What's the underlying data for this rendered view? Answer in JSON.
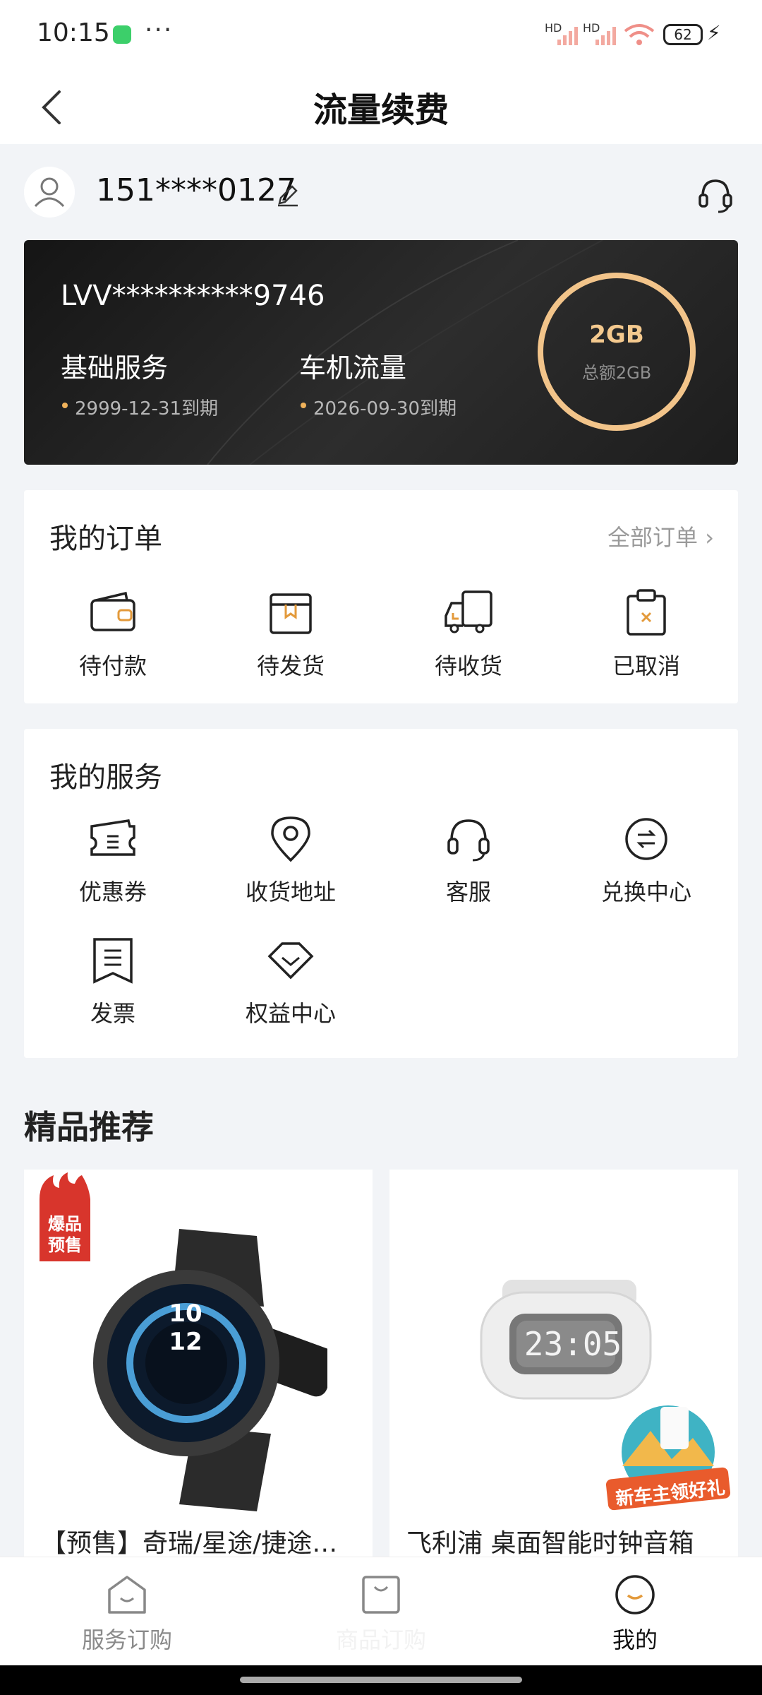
{
  "status_bar": {
    "time": "10:15",
    "battery": "62",
    "sig1": "HD",
    "sig2": "HD"
  },
  "header": {
    "title": "流量续费"
  },
  "user": {
    "phone": "151****0127"
  },
  "card": {
    "vin": "LVV**********9746",
    "services": [
      {
        "label": "基础服务",
        "expiry": "2999-12-31到期"
      },
      {
        "label": "车机流量",
        "expiry": "2026-09-30到期"
      }
    ],
    "data_value": "2GB",
    "data_total": "总额2GB",
    "accent_color": "#f2c48a"
  },
  "orders": {
    "title": "我的订单",
    "all_orders": "全部订单",
    "items": [
      {
        "label": "待付款",
        "icon": "wallet-icon"
      },
      {
        "label": "待发货",
        "icon": "box-icon"
      },
      {
        "label": "待收货",
        "icon": "truck-icon"
      },
      {
        "label": "已取消",
        "icon": "cancel-clipboard-icon"
      }
    ]
  },
  "services": {
    "title": "我的服务",
    "items": [
      {
        "label": "优惠券",
        "icon": "coupon-icon"
      },
      {
        "label": "收货地址",
        "icon": "location-pin-icon"
      },
      {
        "label": "客服",
        "icon": "headset-icon"
      },
      {
        "label": "兑换中心",
        "icon": "exchange-icon"
      },
      {
        "label": "发票",
        "icon": "invoice-icon"
      },
      {
        "label": "权益中心",
        "icon": "diamond-icon"
      }
    ]
  },
  "recommend": {
    "title": "精品推荐",
    "products": [
      {
        "name": "【预售】奇瑞/星途/捷途智能手表",
        "badge": "爆品预售",
        "watch_time_h": "10",
        "watch_time_m": "12"
      },
      {
        "name": "飞利浦 桌面智能时钟音箱",
        "clock_time": "23:05",
        "promo": "新车主领好礼"
      }
    ]
  },
  "tabbar": {
    "items": [
      {
        "label": "服务订购",
        "icon": "home-icon"
      },
      {
        "label": "商品订购",
        "icon": "bag-icon"
      },
      {
        "label": "我的",
        "icon": "profile-icon"
      }
    ],
    "active_index": 2
  }
}
